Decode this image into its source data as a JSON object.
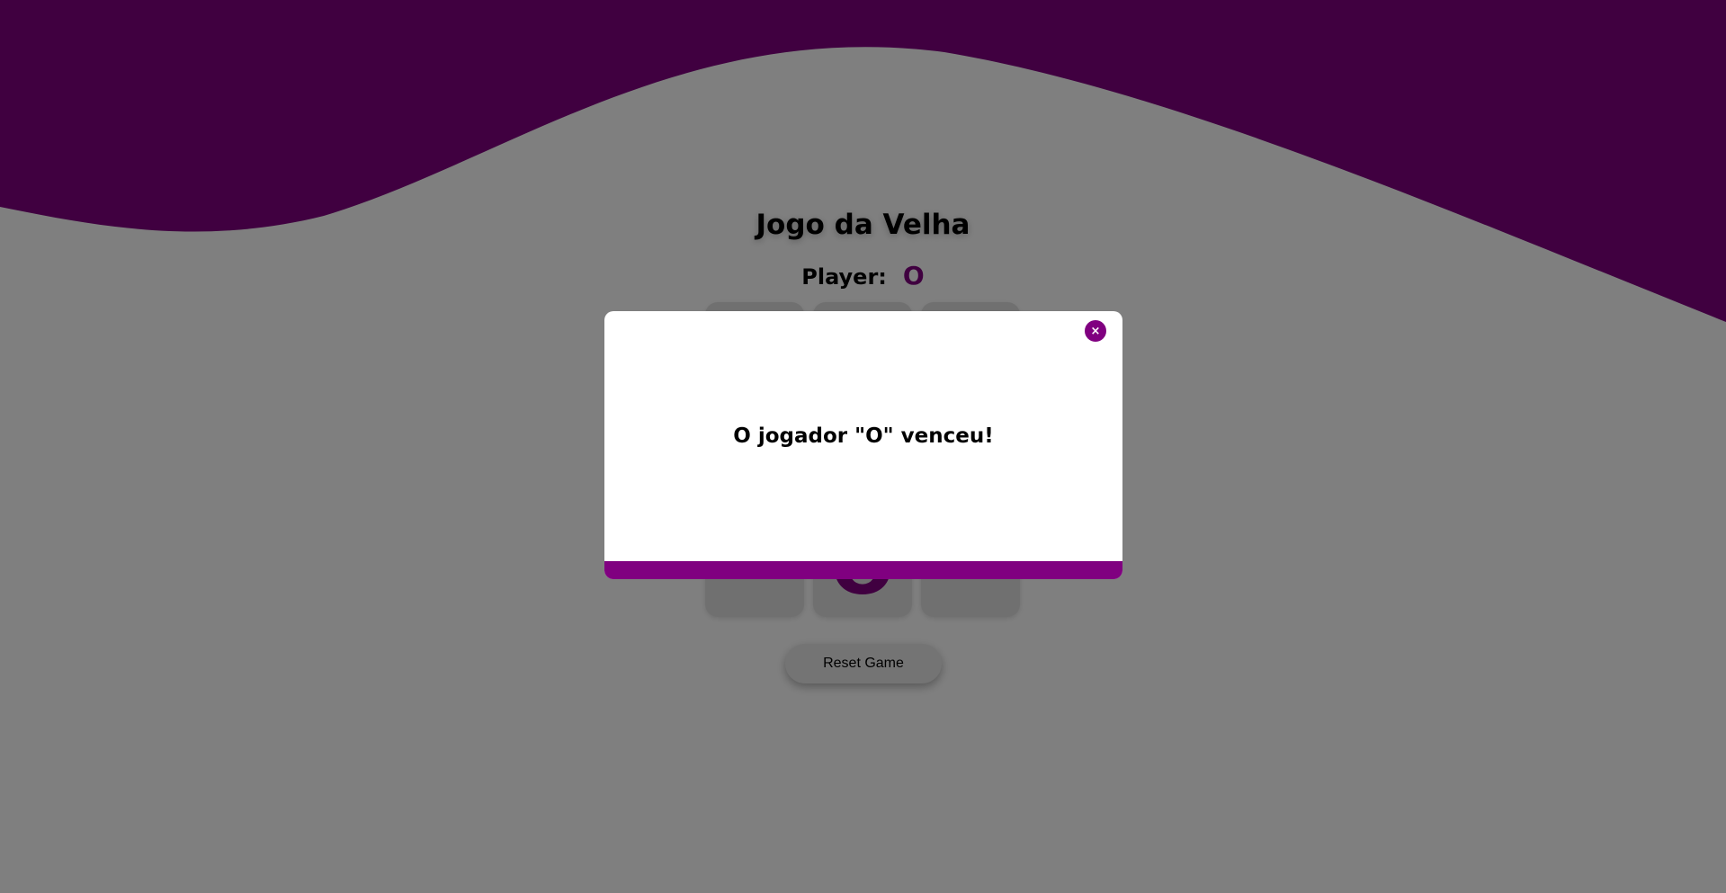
{
  "game": {
    "title": "Jogo da Velha",
    "player_label": "Player:",
    "current_player": "O",
    "board": [
      "",
      "",
      "",
      "",
      "",
      "",
      "",
      "O",
      ""
    ],
    "reset_label": "Reset Game"
  },
  "modal": {
    "message": "O jogador \"O\" venceu!",
    "close_icon": "×"
  },
  "colors": {
    "accent": "#800080",
    "wave": "#800080",
    "overlay": "rgba(0,0,0,0.5)"
  }
}
